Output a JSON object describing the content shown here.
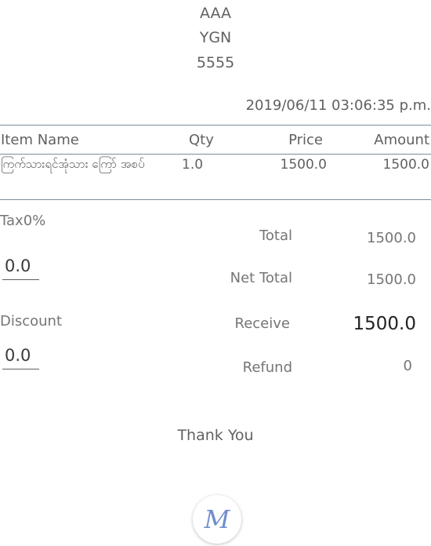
{
  "receipt": {
    "shop_name": "AAA",
    "location": "YGN",
    "phone": "5555",
    "timestamp": "2019/06/11  03:06:35 p.m."
  },
  "table": {
    "headers": {
      "item_name": "Item Name",
      "qty": "Qty",
      "price": "Price",
      "amount": "Amount"
    },
    "rows": [
      {
        "item_name": "ကြက်သားရင်အုံသား ကြော် အစပ်",
        "qty": "1.0",
        "price": "1500.0",
        "amount": "1500.0"
      }
    ]
  },
  "tax": {
    "label": "Tax0%",
    "value": "0.0"
  },
  "discount": {
    "label": "Discount",
    "value": "0.0"
  },
  "totals": {
    "total_label": "Total",
    "total_value": "1500.0",
    "net_total_label": "Net Total",
    "net_total_value": "1500.0",
    "receive_label": "Receive",
    "receive_value": "1500.0",
    "refund_label": "Refund",
    "refund_value": "0"
  },
  "footer": {
    "thanks": "Thank You",
    "logo_letter": "M"
  },
  "colors": {
    "rule": "#7d8c99",
    "logo": "#6f8ecf"
  }
}
